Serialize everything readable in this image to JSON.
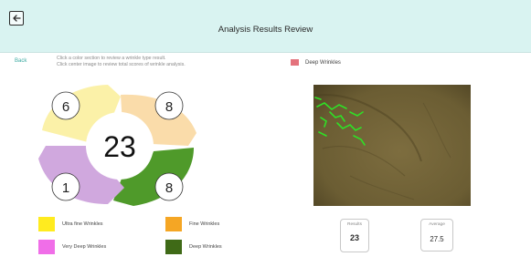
{
  "header": {
    "title": "Analysis Results Review",
    "back_icon": "arrow-left-icon"
  },
  "back_link": "Back",
  "instructions": {
    "line1": "Click a color section to review a wrinkle type result.",
    "line2": "Click center image to review total scores of wrinkle analysis."
  },
  "top_legend": {
    "label": "Deep Wrinkles",
    "color": "#e4727c"
  },
  "wheel": {
    "total": "23",
    "segments": [
      {
        "key": "ultra_fine",
        "count": "6",
        "color": "#fbf1a8"
      },
      {
        "key": "fine",
        "count": "8",
        "color": "#fadcaa"
      },
      {
        "key": "deep",
        "count": "8",
        "color": "#4f9a2a"
      },
      {
        "key": "very_deep",
        "count": "1",
        "color": "#d0a8de"
      }
    ]
  },
  "metrics": {
    "results": {
      "label": "Results",
      "value": "23"
    },
    "average": {
      "label": "Average",
      "value": "27.5"
    }
  },
  "legend": [
    {
      "label": "Ultra fine Wrinkles",
      "color": "#ffeb1f"
    },
    {
      "label": "Fine Wrinkles",
      "color": "#f5a624"
    },
    {
      "label": "Very Deep Wrinkles",
      "color": "#f06ee8"
    },
    {
      "label": "Deep Wrinkles",
      "color": "#3f6a17"
    }
  ]
}
